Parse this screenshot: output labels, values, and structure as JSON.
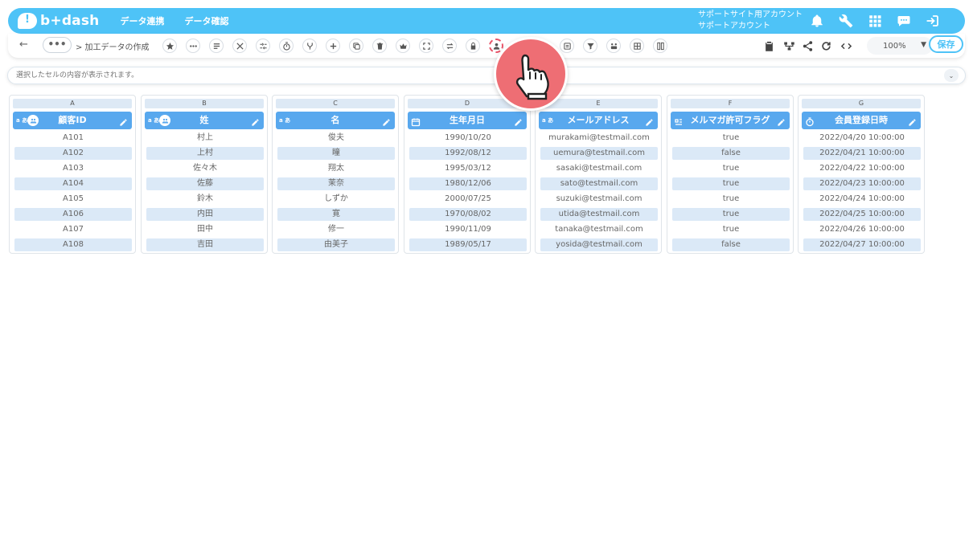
{
  "header": {
    "logo_text": "b+dash",
    "nav": [
      "データ連携",
      "データ確認"
    ],
    "account_line1": "サポートサイト用アカウント",
    "account_line2": "サポートアカウント",
    "icons": [
      "bell-icon",
      "wrench-icon",
      "apps-grid-icon",
      "chat-bubble-icon",
      "logout-icon"
    ]
  },
  "toolbar": {
    "more_label": "•••",
    "breadcrumb": "> 加工データの作成",
    "zoom_value": "100%",
    "save_label": "保存",
    "highlighted_tool": "user-extract-icon"
  },
  "formula_bar": {
    "placeholder": "選択したセルの内容が表示されます。"
  },
  "columns": [
    {
      "letter": "A",
      "name": "顧客ID",
      "type_label": "a あ",
      "type_icon": "text-type-icon",
      "meta_icon": "group-icon",
      "values": [
        "A101",
        "A102",
        "A103",
        "A104",
        "A105",
        "A106",
        "A107",
        "A108"
      ]
    },
    {
      "letter": "B",
      "name": "姓",
      "type_label": "a あ",
      "type_icon": "text-type-icon",
      "meta_icon": "group-icon",
      "values": [
        "村上",
        "上村",
        "佐々木",
        "佐藤",
        "鈴木",
        "内田",
        "田中",
        "吉田"
      ]
    },
    {
      "letter": "C",
      "name": "名",
      "type_label": "a あ",
      "type_icon": "text-type-icon",
      "meta_icon": "",
      "values": [
        "俊夫",
        "瞳",
        "翔太",
        "茉奈",
        "しずか",
        "寛",
        "修一",
        "由美子"
      ]
    },
    {
      "letter": "D",
      "name": "生年月日",
      "type_label": "",
      "type_icon": "calendar-icon",
      "meta_icon": "",
      "values": [
        "1990/10/20",
        "1992/08/12",
        "1995/03/12",
        "1980/12/06",
        "2000/07/25",
        "1970/08/02",
        "1990/11/09",
        "1989/05/17"
      ]
    },
    {
      "letter": "E",
      "name": "メールアドレス",
      "type_label": "a あ",
      "type_icon": "text-type-icon",
      "meta_icon": "",
      "values": [
        "murakami@testmail.com",
        "uemura@testmail.com",
        "sasaki@testmail.com",
        "sato@testmail.com",
        "suzuki@testmail.com",
        "utida@testmail.com",
        "tanaka@testmail.com",
        "yosida@testmail.com"
      ]
    },
    {
      "letter": "F",
      "name": "メルマガ許可フラグ",
      "type_label": "",
      "type_icon": "boolean-icon",
      "meta_icon": "",
      "values": [
        "true",
        "false",
        "true",
        "true",
        "true",
        "true",
        "true",
        "false"
      ]
    },
    {
      "letter": "G",
      "name": "会員登録日時",
      "type_label": "",
      "type_icon": "clock-icon",
      "meta_icon": "",
      "values": [
        "2022/04/20 10:00:00",
        "2022/04/21 10:00:00",
        "2022/04/22 10:00:00",
        "2022/04/23 10:00:00",
        "2022/04/24 10:00:00",
        "2022/04/25 10:00:00",
        "2022/04/26 10:00:00",
        "2022/04/27 10:00:00"
      ]
    }
  ],
  "colors": {
    "brand": "#4ec3f7",
    "header_blue": "#58a8ee",
    "row_alt": "#dbe9f7",
    "highlight": "#e8556a"
  }
}
